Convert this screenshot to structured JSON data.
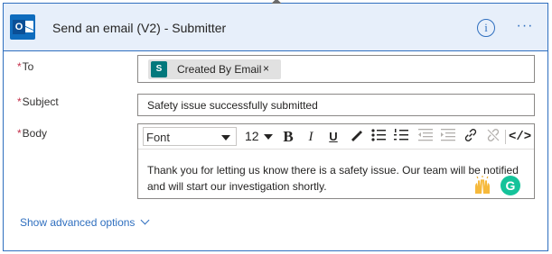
{
  "header": {
    "title": "Send an email (V2) - Submitter",
    "app_icon": "outlook-icon",
    "app_icon_letter": "O",
    "info_icon": "info-icon",
    "info_glyph": "i",
    "more_icon": "more-options-icon",
    "more_glyph": "···"
  },
  "fields": {
    "to": {
      "label": "To",
      "required_mark": "*",
      "token_icon": "sharepoint-icon",
      "token_icon_letter": "S",
      "token_text": "Created By Email",
      "token_remove": "×"
    },
    "subject": {
      "label": "Subject",
      "required_mark": "*",
      "value": "Safety issue successfully submitted"
    },
    "body": {
      "label": "Body",
      "required_mark": "*",
      "toolbar": {
        "font": "Font",
        "font_size": "12",
        "bold": "B",
        "italic": "I",
        "underline": "U",
        "code_view": "</>"
      },
      "text": "Thank you for letting us know there is a safety issue. Our team will be notified and will start our investigation shortly.",
      "emoji_icon": "raised-hands-emoji-icon",
      "grammarly_icon": "grammarly-icon",
      "grammarly_letter": "G"
    }
  },
  "footer": {
    "advanced_options": "Show advanced options"
  },
  "colors": {
    "accent": "#2f6fbf",
    "header_bg": "#e7effa",
    "required": "#c4314b",
    "sharepoint": "#03787c",
    "grammarly": "#15c39a"
  }
}
